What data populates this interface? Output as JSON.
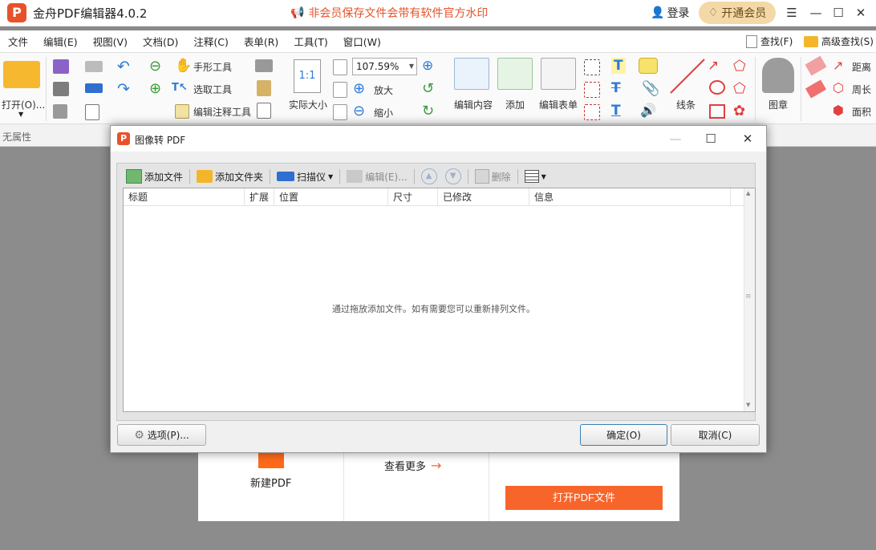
{
  "app": {
    "title": "金舟PDF编辑器4.0.2",
    "logo_letter": "P",
    "notice": "非会员保存文件会带有软件官方水印",
    "login": "登录",
    "vip": "开通会员",
    "accent": "#e8522b"
  },
  "menu": [
    "文件",
    "编辑(E)",
    "视图(V)",
    "文档(D)",
    "注释(C)",
    "表单(R)",
    "工具(T)",
    "窗口(W)"
  ],
  "search": {
    "find": "查找(F)",
    "advanced": "高级查找(S)"
  },
  "toolbar": {
    "open": "打开(O)...",
    "hand": "手形工具",
    "select": "选取工具",
    "edit_annot": "编辑注释工具",
    "actual_size": "实际大小",
    "zoom": "107.59%",
    "zoom_in": "放大",
    "zoom_out": "缩小",
    "edit_content": "编辑内容",
    "add": "添加",
    "edit_form": "编辑表单",
    "line": "线条",
    "stamp": "图章",
    "distance": "距离",
    "perimeter": "周长",
    "area": "面积"
  },
  "props": "无属性",
  "start": {
    "new_pdf": "新建PDF",
    "see_more": "查看更多",
    "open_pdf": "打开PDF文件"
  },
  "dialog": {
    "title": "图像转 PDF",
    "logo_letter": "P",
    "tools": {
      "add_file": "添加文件",
      "add_folder": "添加文件夹",
      "scanner": "扫描仪",
      "edit": "编辑(E)...",
      "delete": "删除"
    },
    "columns": [
      "标题",
      "扩展",
      "位置",
      "尺寸",
      "已修改",
      "信息"
    ],
    "empty": "通过拖放添加文件。如有需要您可以重新排列文件。",
    "options": "选项(P)...",
    "ok": "确定(O)",
    "cancel": "取消(C)"
  }
}
